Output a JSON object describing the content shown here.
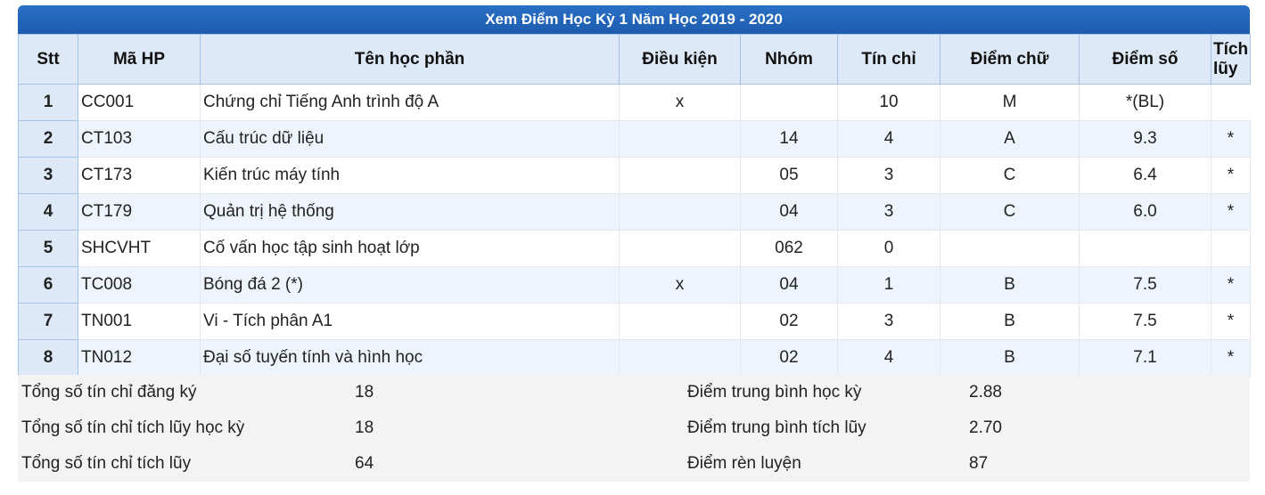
{
  "title": "Xem Điểm Học Kỳ 1 Năm Học 2019 - 2020",
  "headers": {
    "stt": "Stt",
    "ma_hp": "Mã HP",
    "ten_hp": "Tên học phần",
    "dieu_kien": "Điều kiện",
    "nhom": "Nhóm",
    "tin_chi": "Tín chỉ",
    "diem_chu": "Điểm chữ",
    "diem_so": "Điểm số",
    "tich_luy_1": "Tích",
    "tich_luy_2": "lũy"
  },
  "rows": [
    {
      "stt": "1",
      "ma_hp": "CC001",
      "ten_hp": "Chứng chỉ Tiếng Anh trình độ A",
      "dieu_kien": "x",
      "nhom": "",
      "tin_chi": "10",
      "diem_chu": "M",
      "diem_so": "*(BL)",
      "tich_luy": ""
    },
    {
      "stt": "2",
      "ma_hp": "CT103",
      "ten_hp": "Cấu trúc dữ liệu",
      "dieu_kien": "",
      "nhom": "14",
      "tin_chi": "4",
      "diem_chu": "A",
      "diem_so": "9.3",
      "tich_luy": "*"
    },
    {
      "stt": "3",
      "ma_hp": "CT173",
      "ten_hp": "Kiến trúc máy tính",
      "dieu_kien": "",
      "nhom": "05",
      "tin_chi": "3",
      "diem_chu": "C",
      "diem_so": "6.4",
      "tich_luy": "*"
    },
    {
      "stt": "4",
      "ma_hp": "CT179",
      "ten_hp": "Quản trị hệ thống",
      "dieu_kien": "",
      "nhom": "04",
      "tin_chi": "3",
      "diem_chu": "C",
      "diem_so": "6.0",
      "tich_luy": "*"
    },
    {
      "stt": "5",
      "ma_hp": "SHCVHT",
      "ten_hp": "Cố vấn học tập sinh hoạt lớp",
      "dieu_kien": "",
      "nhom": "062",
      "tin_chi": "0",
      "diem_chu": "",
      "diem_so": "",
      "tich_luy": ""
    },
    {
      "stt": "6",
      "ma_hp": "TC008",
      "ten_hp": "Bóng đá 2 (*)",
      "dieu_kien": "x",
      "nhom": "04",
      "tin_chi": "1",
      "diem_chu": "B",
      "diem_so": "7.5",
      "tich_luy": "*"
    },
    {
      "stt": "7",
      "ma_hp": "TN001",
      "ten_hp": "Vi - Tích phân A1",
      "dieu_kien": "",
      "nhom": "02",
      "tin_chi": "3",
      "diem_chu": "B",
      "diem_so": "7.5",
      "tich_luy": "*"
    },
    {
      "stt": "8",
      "ma_hp": "TN012",
      "ten_hp": "Đại số tuyến tính và hình học",
      "dieu_kien": "",
      "nhom": "02",
      "tin_chi": "4",
      "diem_chu": "B",
      "diem_so": "7.1",
      "tich_luy": "*"
    }
  ],
  "summary": {
    "left": [
      {
        "label": "Tổng số tín chỉ đăng ký",
        "value": "18"
      },
      {
        "label": "Tổng số tín chỉ tích lũy học kỳ",
        "value": "18"
      },
      {
        "label": "Tổng số tín chỉ tích lũy",
        "value": "64"
      }
    ],
    "right": [
      {
        "label": "Điểm trung bình học kỳ",
        "value": "2.88"
      },
      {
        "label": "Điểm trung bình tích lũy",
        "value": "2.70"
      },
      {
        "label": "Điểm rèn luyện",
        "value": "87"
      }
    ]
  }
}
